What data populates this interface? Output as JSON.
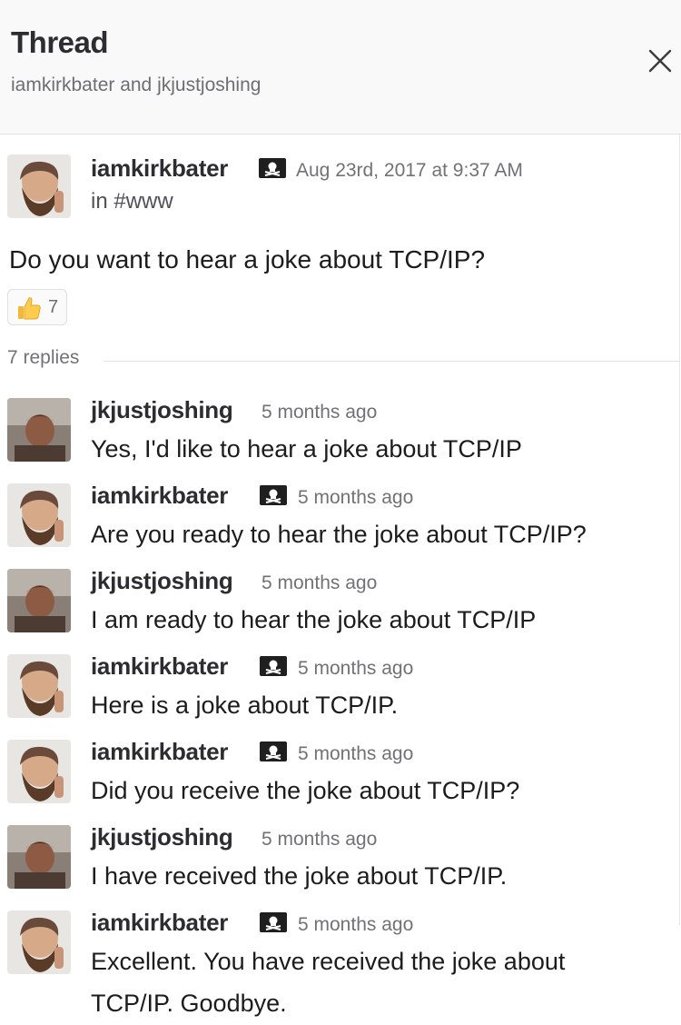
{
  "header": {
    "title": "Thread",
    "participants": "iamkirkbater and jkjustjoshing"
  },
  "parent": {
    "author": "iamkirkbater",
    "timestamp": "Aug 23rd, 2017 at 9:37 AM",
    "channel": "in #www",
    "text": "Do you want to hear a joke about TCP/IP?",
    "reaction": {
      "emoji": "thumbs-up-icon",
      "count": "7"
    }
  },
  "replies_label": "7 replies",
  "replies": [
    {
      "author": "jkjustjoshing",
      "timestamp": "5 months ago",
      "lines": [
        "Yes, I'd like to hear a joke about TCP/IP"
      ]
    },
    {
      "author": "iamkirkbater",
      "timestamp": "5 months ago",
      "lines": [
        "Are you ready to hear the joke about TCP/IP?"
      ]
    },
    {
      "author": "jkjustjoshing",
      "timestamp": "5 months ago",
      "lines": [
        "I am ready to hear the joke about TCP/IP"
      ]
    },
    {
      "author": "iamkirkbater",
      "timestamp": "5 months ago",
      "lines": [
        "Here is a joke about TCP/IP."
      ]
    },
    {
      "author": "iamkirkbater",
      "timestamp": "5 months ago",
      "lines": [
        "Did you receive the joke about TCP/IP?"
      ]
    },
    {
      "author": "jkjustjoshing",
      "timestamp": "5 months ago",
      "lines": [
        "I have received the joke about TCP/IP."
      ]
    },
    {
      "author": "iamkirkbater",
      "timestamp": "5 months ago",
      "lines": [
        "Excellent.  You have received the joke about",
        "TCP/IP.  Goodbye."
      ]
    }
  ],
  "colors": {
    "accent_text": "#2c2d30",
    "muted_text": "#717274",
    "header_bg": "#f9f9f9"
  }
}
